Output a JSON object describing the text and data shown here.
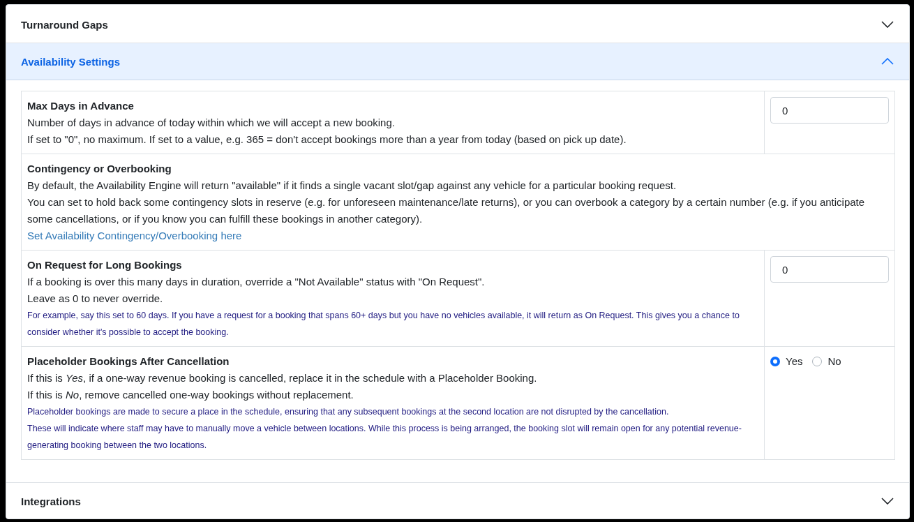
{
  "sections": [
    {
      "title": "Turnaround Gaps",
      "expanded": false
    },
    {
      "title": "Availability Settings",
      "expanded": true,
      "settings": [
        {
          "title": "Max Days in Advance",
          "lines": [
            {
              "kind": "text",
              "text": "Number of days in advance of today within which we will accept a new booking."
            },
            {
              "kind": "text",
              "text": "If set to \"0\", no maximum. If set to a value, e.g. 365 = don't accept bookings more than a year from today (based on pick up date)."
            }
          ],
          "control": {
            "kind": "number",
            "value": "0"
          }
        },
        {
          "title": "Contingency or Overbooking",
          "lines": [
            {
              "kind": "text",
              "text": "By default, the Availability Engine will return \"available\" if it finds a single vacant slot/gap against any vehicle for a particular booking request."
            },
            {
              "kind": "text",
              "text": "You can set to hold back some contingency slots in reserve (e.g. for unforeseen maintenance/late returns), or you can overbook a category by a certain number (e.g. if you anticipate some cancellations, or if you know you can fulfill these bookings in another category)."
            },
            {
              "kind": "link",
              "text": "Set Availability Contingency/Overbooking here"
            }
          ]
        },
        {
          "title": "On Request for Long Bookings",
          "lines": [
            {
              "kind": "text",
              "text": "If a booking is over this many days in duration, override a \"Not Available\" status with \"On Request\"."
            },
            {
              "kind": "text",
              "text": "Leave as 0 to never override."
            },
            {
              "kind": "note",
              "text": "For example, say this set to 60 days. If you have a request for a booking that spans 60+ days but you have no vehicles available, it will return as On Request. This gives you a chance to consider whether it's possible to accept the booking."
            }
          ],
          "control": {
            "kind": "number",
            "value": "0"
          }
        },
        {
          "title": "Placeholder Bookings After Cancellation",
          "lines": [
            {
              "kind": "text",
              "text": "If this is *Yes*, if a one-way revenue booking is cancelled, replace it in the schedule with a Placeholder Booking."
            },
            {
              "kind": "text",
              "text": "If this is *No*, remove cancelled one-way bookings without replacement."
            },
            {
              "kind": "note",
              "text": "Placeholder bookings are made to secure a place in the schedule, ensuring that any subsequent bookings at the second location are not disrupted by the cancellation."
            },
            {
              "kind": "note",
              "text": "These will indicate where staff may have to manually move a vehicle between locations. While this process is being arranged, the booking slot will remain open for any potential revenue-generating booking between the two locations."
            }
          ],
          "control": {
            "kind": "radio",
            "options": [
              {
                "label": "Yes",
                "selected": true
              },
              {
                "label": "No",
                "selected": false
              }
            ]
          }
        }
      ]
    },
    {
      "title": "Integrations",
      "expanded": false
    }
  ]
}
